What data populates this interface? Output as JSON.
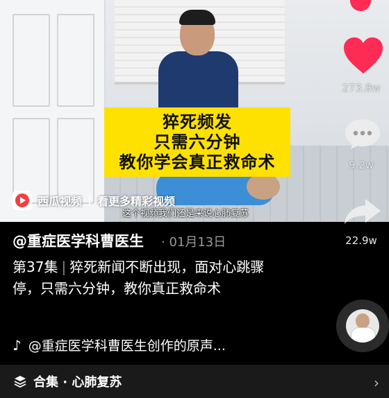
{
  "video": {
    "overlay_lines": [
      "猝死频发",
      "只需六分钟",
      "教你学会真正救命术"
    ],
    "watermark_brand": "西瓜视频",
    "watermark_cta": "看更多精彩视频",
    "subtitle": "这个视频我们还是来说心肺复苏"
  },
  "sidebar": {
    "likes": "273.8w",
    "comments": "9.2w",
    "shares": "22.9w",
    "like_icon": "heart-icon",
    "comment_icon": "comment-bubble-icon",
    "share_icon": "share-arrow-icon",
    "like_color": "#fe2c55"
  },
  "post": {
    "author": "@重症医学科曹医生",
    "date": "· 01月13日",
    "episode": "第37集",
    "description": "猝死新闻不断出现，面对心跳骤停，只需六分钟，教你真正救命术"
  },
  "music": {
    "icon": "tiktok-note-icon",
    "text": "@重症医学科曹医生创作的原声..."
  },
  "collection": {
    "icon": "stack-icon",
    "label": "合集 · 心肺复苏"
  }
}
